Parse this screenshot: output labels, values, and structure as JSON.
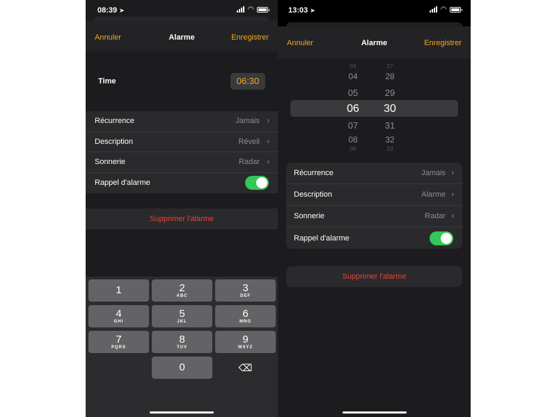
{
  "left": {
    "status": {
      "time": "08:39",
      "location_icon": "location-arrow-icon"
    },
    "nav": {
      "cancel": "Annuler",
      "title": "Alarme",
      "save": "Enregistrer"
    },
    "time_row": {
      "label": "Time",
      "value": "06:30"
    },
    "rows": [
      {
        "label": "Récurrence",
        "value": "Jamais"
      },
      {
        "label": "Description",
        "value": "Réveil"
      },
      {
        "label": "Sonnerie",
        "value": "Radar"
      }
    ],
    "snooze": {
      "label": "Rappel d'alarme",
      "on": true
    },
    "delete": "Supprimer l'alarme",
    "keypad": [
      {
        "digit": "1",
        "letters": ""
      },
      {
        "digit": "2",
        "letters": "ABC"
      },
      {
        "digit": "3",
        "letters": "DEF"
      },
      {
        "digit": "4",
        "letters": "GHI"
      },
      {
        "digit": "5",
        "letters": "JKL"
      },
      {
        "digit": "6",
        "letters": "MNO"
      },
      {
        "digit": "7",
        "letters": "PQRS"
      },
      {
        "digit": "8",
        "letters": "TUV"
      },
      {
        "digit": "9",
        "letters": "WXYZ"
      },
      {
        "digit": "0",
        "letters": ""
      }
    ],
    "backspace_icon": "backspace-icon"
  },
  "right": {
    "status": {
      "time": "13:03",
      "location_icon": "location-arrow-icon"
    },
    "nav": {
      "cancel": "Annuler",
      "title": "Alarme",
      "save": "Enregistrer"
    },
    "picker": {
      "hours": [
        "03",
        "04",
        "05",
        "06",
        "07",
        "08",
        "09"
      ],
      "minutes": [
        "27",
        "28",
        "29",
        "30",
        "31",
        "32",
        "33"
      ],
      "selected_hour": "06",
      "selected_minute": "30"
    },
    "rows": [
      {
        "label": "Récurrence",
        "value": "Jamais"
      },
      {
        "label": "Description",
        "value": "Alarme"
      },
      {
        "label": "Sonnerie",
        "value": "Radar"
      }
    ],
    "snooze": {
      "label": "Rappel d'alarme",
      "on": true
    },
    "delete": "Supprimer l'alarme"
  },
  "colors": {
    "accent": "#f5a623",
    "destructive": "#e5433a",
    "toggle_on": "#34c759"
  }
}
